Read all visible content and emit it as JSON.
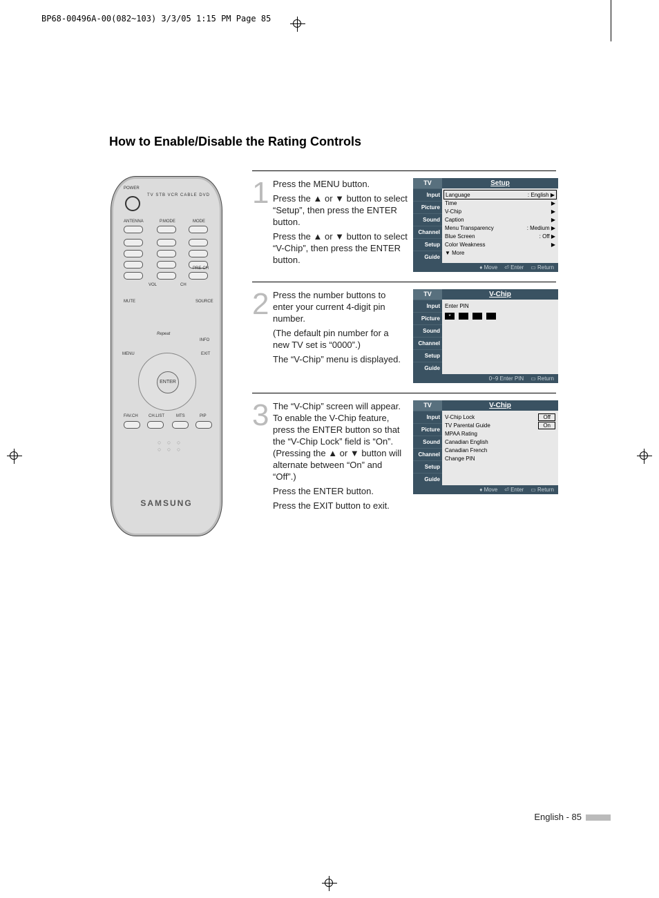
{
  "header_line": "BP68-00496A-00(082~103)  3/3/05  1:15 PM  Page 85",
  "title": "How to Enable/Disable the Rating Controls",
  "remote": {
    "brand": "SAMSUNG",
    "power": "POWER",
    "modes": "TV  STB  VCR  CABLE  DVD",
    "antenna": "ANTENNA",
    "pmode": "P.MODE",
    "mode": "MODE",
    "vol": "VOL",
    "ch": "CH",
    "mute": "MUTE",
    "source": "SOURCE",
    "prech": "PRE-CH",
    "menu": "MENU",
    "info": "INFO",
    "exit": "EXIT",
    "enter": "ENTER",
    "favch": "FAV.CH",
    "chlist": "CH.LIST",
    "mts": "MTS",
    "pip": "PIP",
    "repeat": "Repeat"
  },
  "steps": [
    {
      "num": "1",
      "paragraphs": [
        "Press the MENU button.",
        "Press the ▲ or ▼ button to select “Setup”, then press the ENTER button.",
        "Press the ▲ or ▼ button to select “V-Chip”, then press the ENTER button."
      ]
    },
    {
      "num": "2",
      "paragraphs": [
        "Press the number buttons to enter your current 4-digit pin number.",
        "(The default pin number for a new TV set is “0000”.)",
        "The “V-Chip” menu is displayed."
      ]
    },
    {
      "num": "3",
      "paragraphs": [
        "The “V-Chip” screen will appear. To enable the V-Chip feature, press the ENTER button so that the “V-Chip Lock” field is “On”. (Pressing the ▲ or ▼ button will alternate between “On” and “Off”.)",
        "Press the ENTER button.",
        "",
        "Press the EXIT button to exit."
      ]
    }
  ],
  "osd1": {
    "tv": "TV",
    "title": "Setup",
    "side": [
      "Input",
      "Picture",
      "Sound",
      "Channel",
      "Setup",
      "Guide"
    ],
    "rows": [
      {
        "l": "Language",
        "r": ": English",
        "arrow": true,
        "boxed": true
      },
      {
        "l": "Time",
        "r": "",
        "arrow": true
      },
      {
        "l": "V-Chip",
        "r": "",
        "arrow": true
      },
      {
        "l": "Caption",
        "r": "",
        "arrow": true
      },
      {
        "l": "Menu Transparency",
        "r": ": Medium",
        "arrow": true
      },
      {
        "l": "Blue Screen",
        "r": ": Off",
        "arrow": true
      },
      {
        "l": "Color Weakness",
        "r": "",
        "arrow": true
      },
      {
        "l": "▼ More",
        "r": "",
        "arrow": false
      }
    ],
    "foot": [
      "Move",
      "Enter",
      "Return"
    ]
  },
  "osd2": {
    "tv": "TV",
    "title": "V-Chip",
    "side": [
      "Input",
      "Picture",
      "Sound",
      "Channel",
      "Setup",
      "Guide"
    ],
    "prompt": "Enter PIN",
    "entered": "*",
    "foot": [
      "0~9 Enter PIN",
      "Return"
    ]
  },
  "osd3": {
    "tv": "TV",
    "title": "V-Chip",
    "side": [
      "Input",
      "Picture",
      "Sound",
      "Channel",
      "Setup",
      "Guide"
    ],
    "rows": [
      {
        "l": "V-Chip Lock",
        "r": "Off",
        "boxed": "r"
      },
      {
        "l": "TV Parental Guide",
        "r": "On",
        "boxed": "r"
      },
      {
        "l": "MPAA Rating",
        "r": ""
      },
      {
        "l": "Canadian English",
        "r": ""
      },
      {
        "l": "Canadian French",
        "r": ""
      },
      {
        "l": "Change PIN",
        "r": ""
      }
    ],
    "foot": [
      "Move",
      "Enter",
      "Return"
    ]
  },
  "footer": "English - 85"
}
